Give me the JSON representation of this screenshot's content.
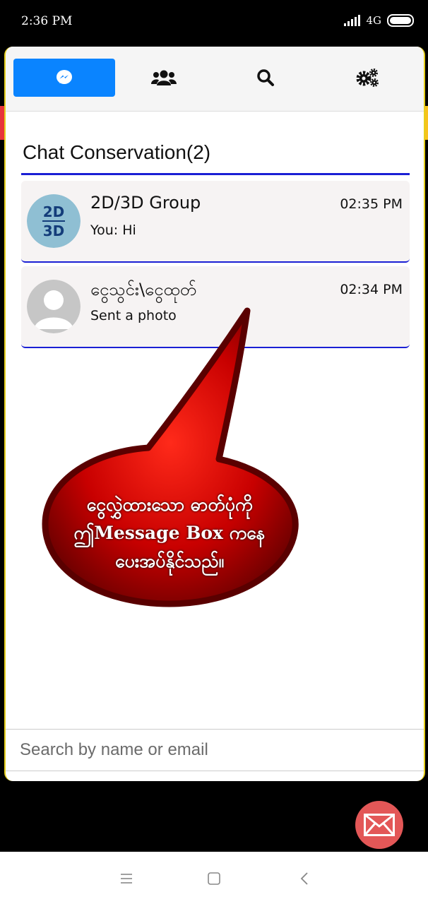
{
  "status": {
    "time": "2:36 PM",
    "network": "4G"
  },
  "tabs": [
    {
      "icon": "messenger-icon",
      "active": true
    },
    {
      "icon": "users-icon",
      "active": false
    },
    {
      "icon": "search-icon",
      "active": false
    },
    {
      "icon": "settings-icon",
      "active": false
    }
  ],
  "heading": "Chat Conservation(2)",
  "chats": [
    {
      "name": "2D/3D Group",
      "time": "02:35 PM",
      "message": "You: Hi",
      "avatar_text_top": "2D",
      "avatar_text_bottom": "3D"
    },
    {
      "name": "ငွေသွင်း\\ငွေထုတ်",
      "time": "02:34 PM",
      "message": "Sent a photo"
    }
  ],
  "callout": {
    "line1": "ငွေလွှဲထားသော ဓာတ်ပုံကို",
    "line2": "ဤMessage Box ကနေ",
    "line3": "ပေးအပ်နိုင်သည်။"
  },
  "search": {
    "placeholder": "Search by name or email"
  },
  "colors": {
    "accent": "#0a84ff",
    "rule": "#1a1fd4",
    "fab": "#e35757",
    "callout": "#d40000"
  }
}
